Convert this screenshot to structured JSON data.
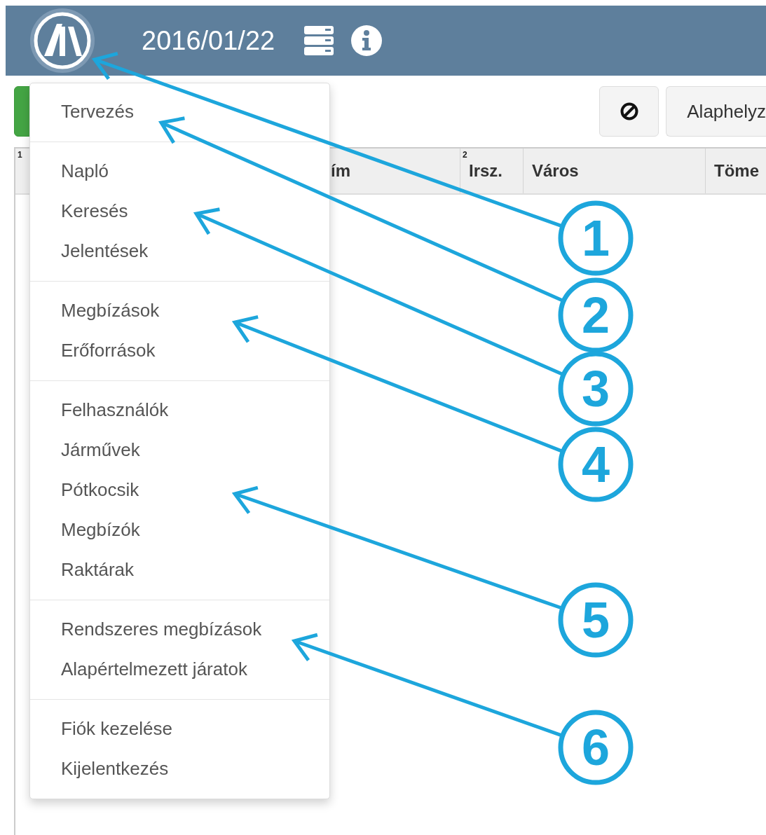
{
  "header": {
    "date": "2016/01/22"
  },
  "toolbar": {
    "reset_button": "Alaphelyz"
  },
  "table": {
    "columns": [
      {
        "sort_index": "1"
      },
      {
        "label": "ím"
      },
      {
        "label": "Irsz.",
        "sort_index": "2"
      },
      {
        "label": "Város"
      },
      {
        "label": "Töme"
      }
    ]
  },
  "menu": {
    "groups": [
      {
        "items": [
          {
            "label": "Tervezés"
          }
        ]
      },
      {
        "items": [
          {
            "label": "Napló"
          },
          {
            "label": "Keresés"
          },
          {
            "label": "Jelentések"
          }
        ]
      },
      {
        "items": [
          {
            "label": "Megbízások"
          },
          {
            "label": "Erőforrások"
          }
        ]
      },
      {
        "items": [
          {
            "label": "Felhasználók"
          },
          {
            "label": "Járművek"
          },
          {
            "label": "Pótkocsik"
          },
          {
            "label": "Megbízók"
          },
          {
            "label": "Raktárak"
          }
        ]
      },
      {
        "items": [
          {
            "label": "Rendszeres megbízások"
          },
          {
            "label": "Alapértelmezett járatok"
          }
        ]
      },
      {
        "items": [
          {
            "label": "Fiók kezelése"
          },
          {
            "label": "Kijelentkezés"
          }
        ]
      }
    ]
  },
  "callouts": [
    {
      "number": "1"
    },
    {
      "number": "2"
    },
    {
      "number": "3"
    },
    {
      "number": "4"
    },
    {
      "number": "5"
    },
    {
      "number": "6"
    }
  ]
}
